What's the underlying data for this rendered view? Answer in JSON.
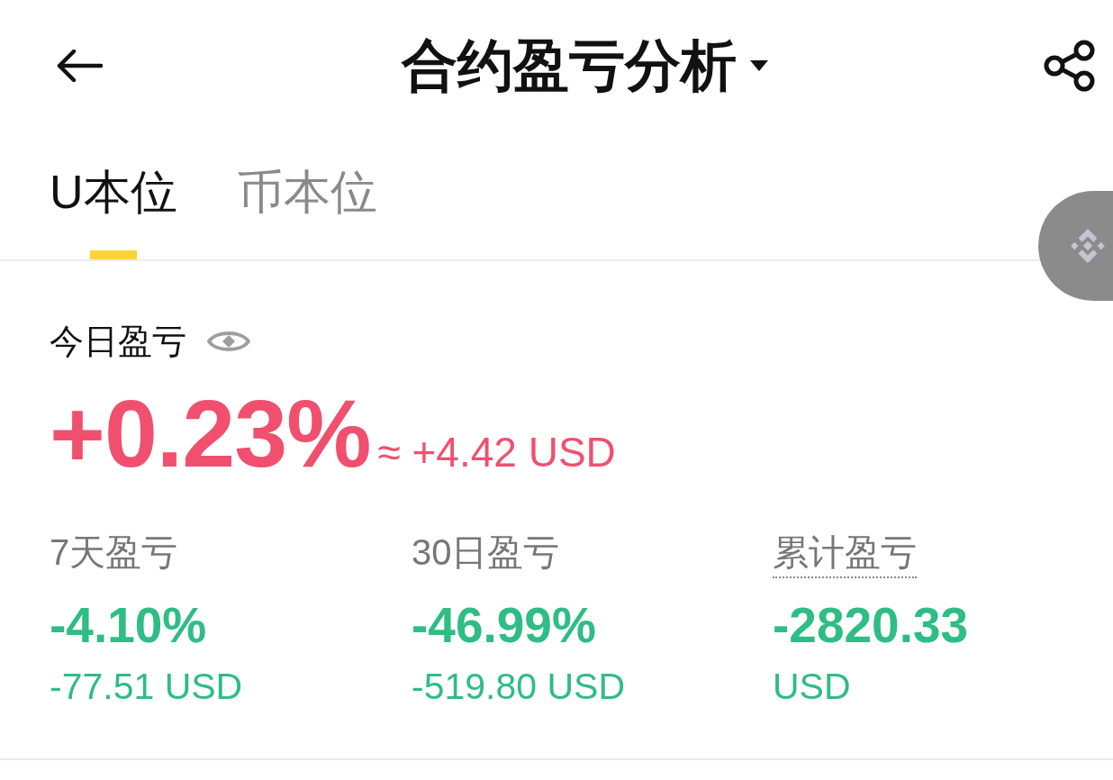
{
  "header": {
    "title": "合约盈亏分析"
  },
  "tabs": [
    {
      "label": "U本位",
      "selected": true
    },
    {
      "label": "币本位",
      "selected": false
    }
  ],
  "today": {
    "label": "今日盈亏",
    "percent": "+0.23%",
    "amount": "≈ +4.42 USD",
    "color": "#f0506e"
  },
  "stats": [
    {
      "label": "7天盈亏",
      "underlined": false,
      "value": "-4.10%",
      "amount": "-77.51 USD",
      "color": "#2ebd85"
    },
    {
      "label": "30日盈亏",
      "underlined": false,
      "value": "-46.99%",
      "amount": "-519.80 USD",
      "color": "#2ebd85"
    },
    {
      "label": "累计盈亏",
      "underlined": true,
      "value": "-2820.33",
      "amount": "USD",
      "color": "#2ebd85"
    }
  ]
}
